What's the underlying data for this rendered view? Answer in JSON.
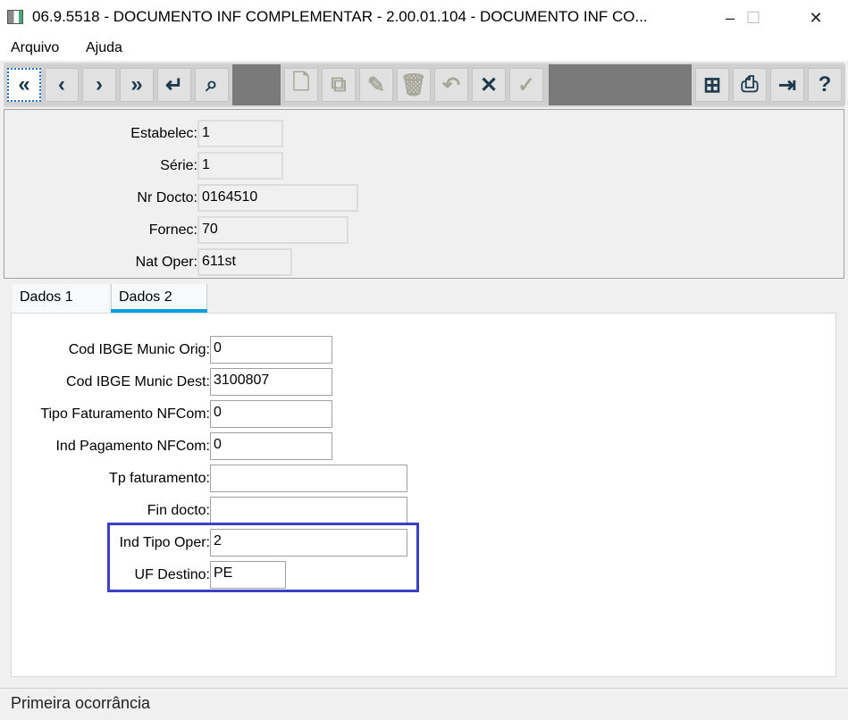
{
  "window": {
    "title": "06.9.5518 - DOCUMENTO INF COMPLEMENTAR - 2.00.01.104 - DOCUMENTO INF CO...",
    "minimize": "–",
    "maximize": "☐",
    "close": "✕"
  },
  "menu": [
    "Arquivo",
    "Ajuda"
  ],
  "toolbar": {
    "nav": [
      {
        "icon": "first-record-icon",
        "glyph": "«"
      },
      {
        "icon": "previous-icon",
        "glyph": "‹"
      },
      {
        "icon": "next-icon",
        "glyph": "›"
      },
      {
        "icon": "last-record-icon",
        "glyph": "»"
      },
      {
        "icon": "goto-icon",
        "glyph": "↵"
      },
      {
        "icon": "search-icon",
        "glyph": "⌕"
      }
    ],
    "edit": [
      {
        "icon": "new-document-icon",
        "glyph": "🗋"
      },
      {
        "icon": "copy-icon",
        "glyph": "⧉"
      },
      {
        "icon": "edit-icon",
        "glyph": "✎"
      },
      {
        "icon": "delete-icon",
        "glyph": "🗑"
      },
      {
        "icon": "undo-icon",
        "glyph": "↶"
      },
      {
        "icon": "cancel-icon",
        "glyph": "✕"
      },
      {
        "icon": "confirm-icon",
        "glyph": "✓"
      }
    ],
    "tools": [
      {
        "icon": "tree-icon",
        "glyph": "⊞"
      },
      {
        "icon": "print-icon",
        "glyph": "⎙"
      },
      {
        "icon": "exit-icon",
        "glyph": "⇥"
      },
      {
        "icon": "help-icon",
        "glyph": "?"
      }
    ]
  },
  "header": {
    "fields": [
      {
        "label": "Estabelec:",
        "value": "1"
      },
      {
        "label": "Série:",
        "value": "1"
      },
      {
        "label": "Nr Docto:",
        "value": "0164510"
      },
      {
        "label": "Fornec:",
        "value": "70"
      },
      {
        "label": "Nat Oper:",
        "value": "611st"
      }
    ]
  },
  "tabs": [
    {
      "label": "Dados 1"
    },
    {
      "label": "Dados 2",
      "active": true
    }
  ],
  "dados2": {
    "fields": [
      {
        "label": "Cod IBGE Munic Orig:",
        "value": "0"
      },
      {
        "label": "Cod IBGE Munic Dest:",
        "value": "3100807"
      },
      {
        "label": "Tipo Faturamento NFCom:",
        "value": "0"
      },
      {
        "label": "Ind Pagamento NFCom:",
        "value": "0"
      },
      {
        "label": "Tp faturamento:",
        "value": ""
      },
      {
        "label": "Fin docto:",
        "value": ""
      },
      {
        "label": "Ind Tipo Oper:",
        "value": "2"
      },
      {
        "label": "UF Destino:",
        "value": "PE"
      }
    ]
  },
  "status": "Primeira ocorrância",
  "colors": {
    "highlight": "#3c40c4",
    "tab_accent": "#0aa0e0",
    "toolbar_bg": "#7a7a7a"
  }
}
